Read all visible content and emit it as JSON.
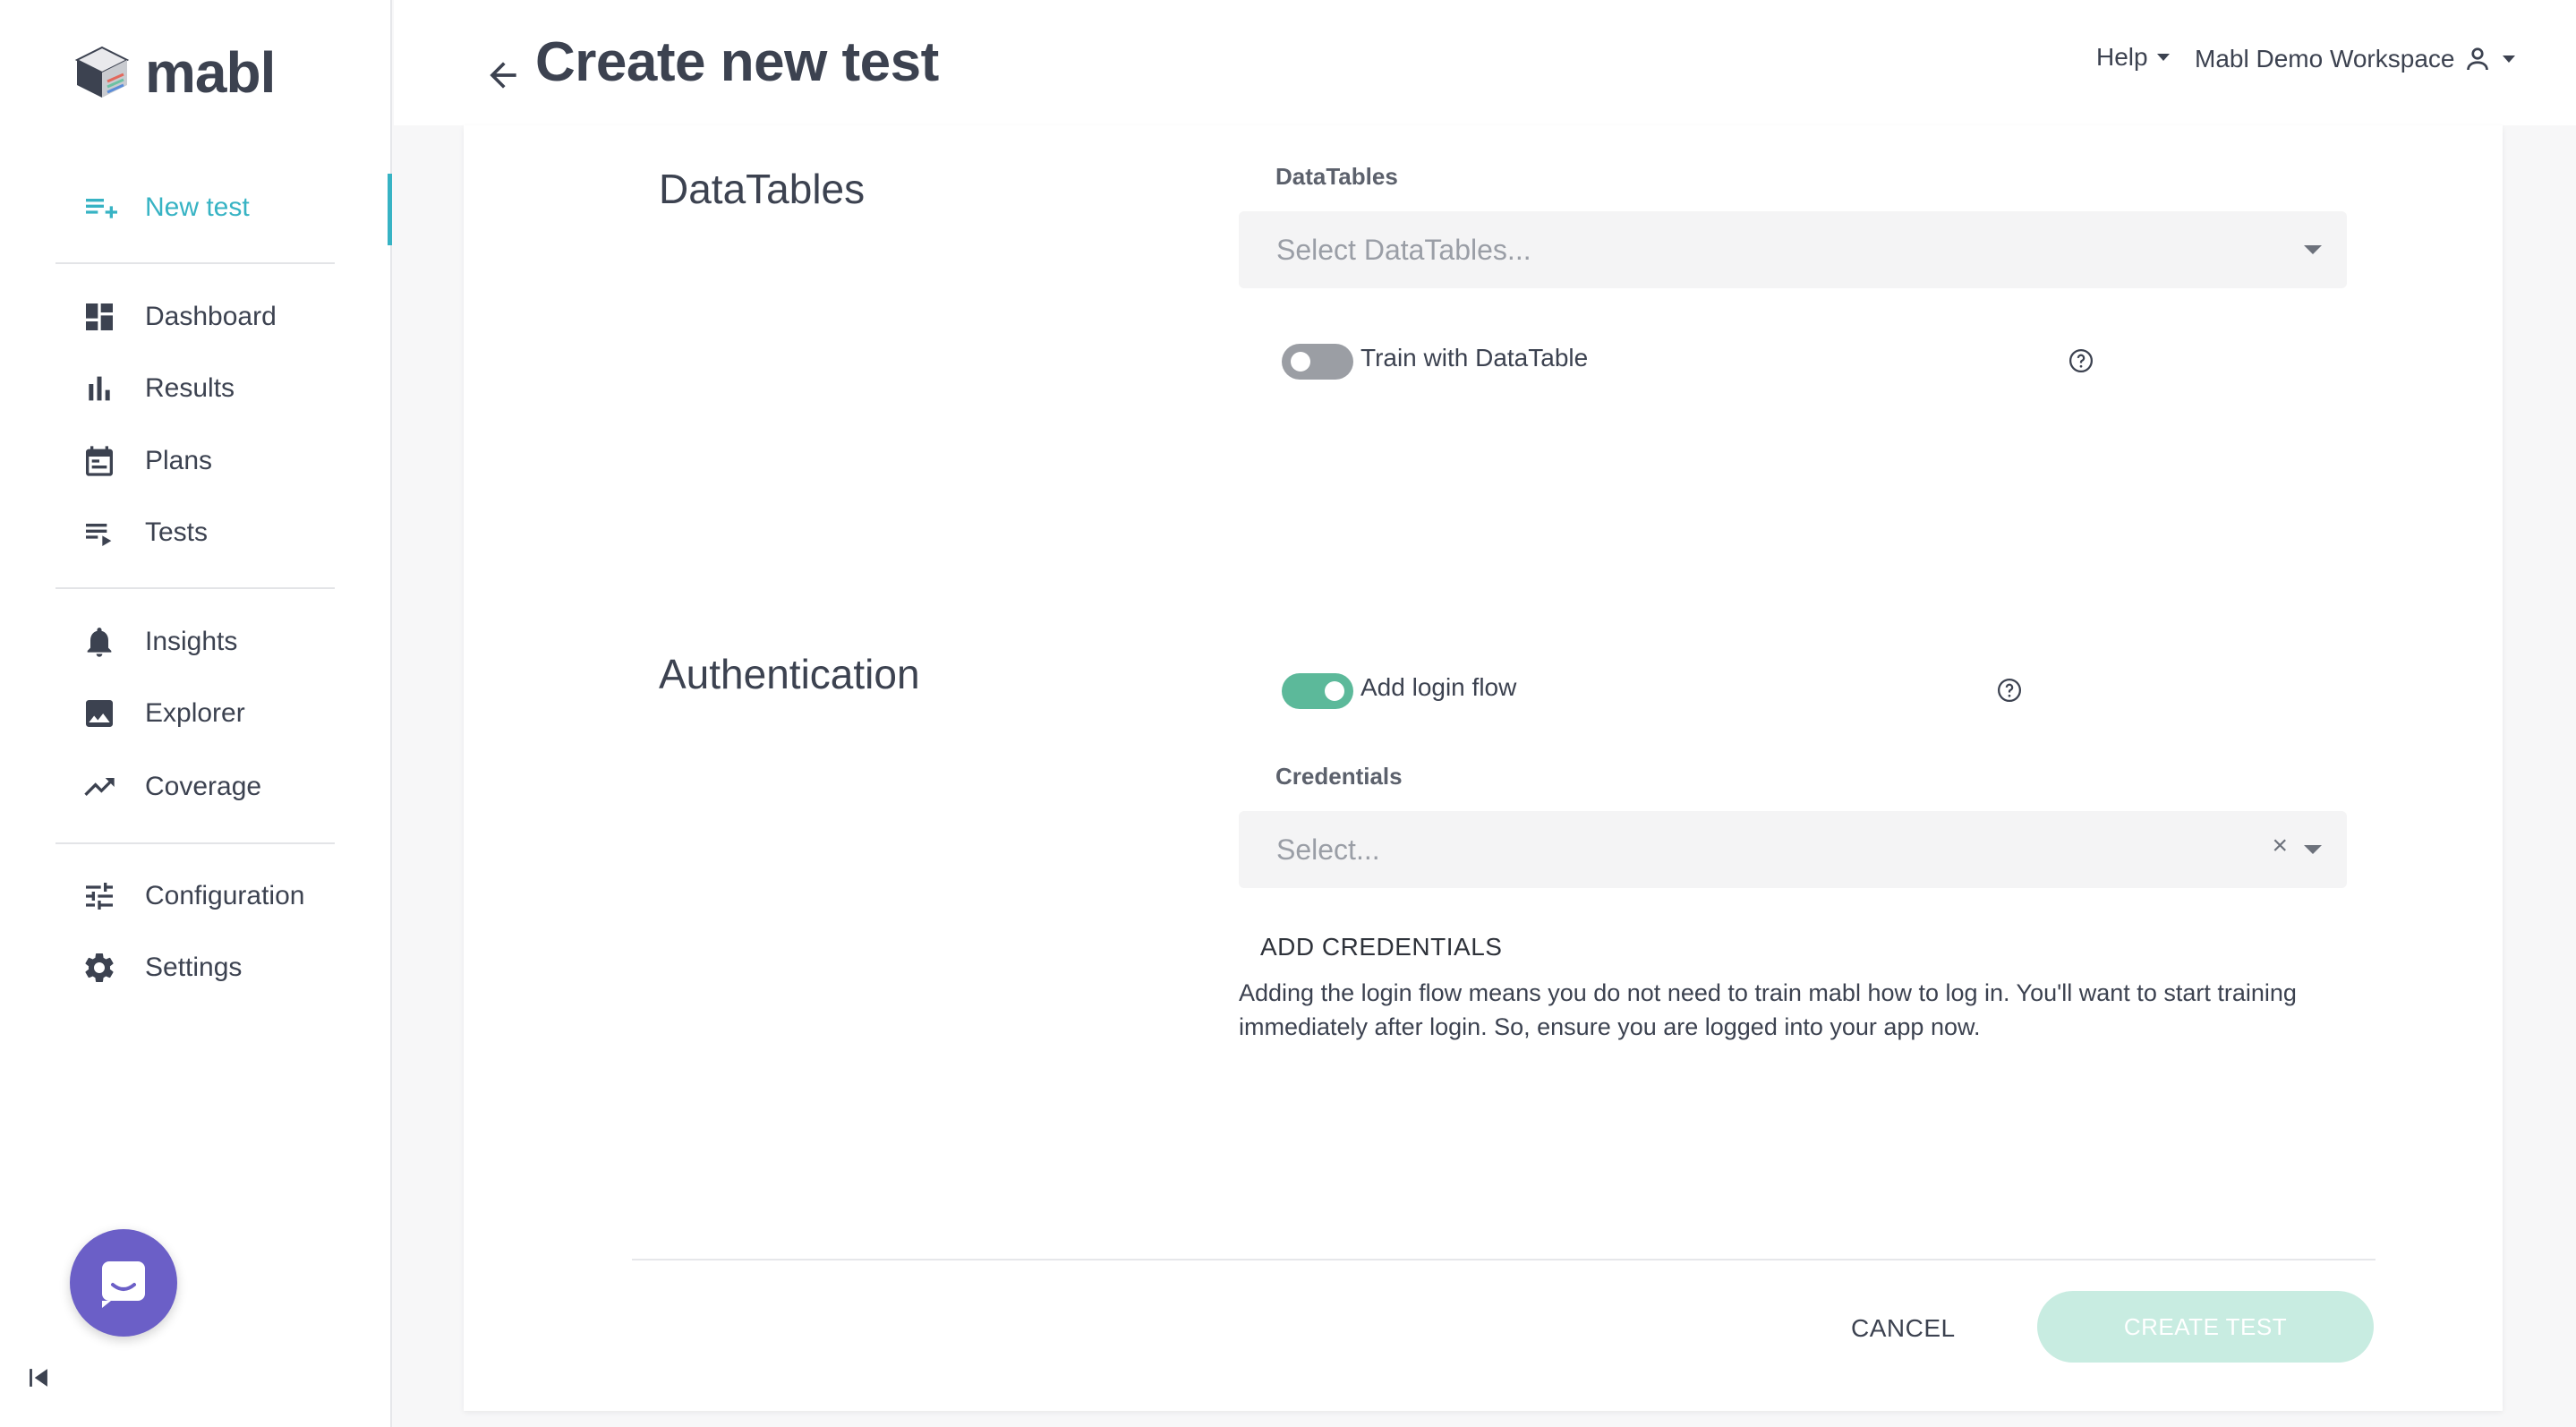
{
  "app": {
    "logo_text": "mabl"
  },
  "header": {
    "title": "Create new test",
    "help_label": "Help",
    "workspace_label": "Mabl Demo Workspace"
  },
  "sidebar": {
    "items": [
      {
        "label": "New test",
        "icon": "new-test-icon",
        "active": true
      },
      {
        "label": "Dashboard",
        "icon": "dashboard-icon"
      },
      {
        "label": "Results",
        "icon": "results-icon"
      },
      {
        "label": "Plans",
        "icon": "calendar-icon"
      },
      {
        "label": "Tests",
        "icon": "tests-icon"
      },
      {
        "label": "Insights",
        "icon": "bell-icon"
      },
      {
        "label": "Explorer",
        "icon": "image-icon"
      },
      {
        "label": "Coverage",
        "icon": "trending-icon"
      },
      {
        "label": "Configuration",
        "icon": "sliders-icon"
      },
      {
        "label": "Settings",
        "icon": "gear-icon"
      }
    ]
  },
  "datatables": {
    "section_title": "DataTables",
    "field_label": "DataTables",
    "placeholder": "Select DataTables...",
    "toggle_label": "Train with DataTable",
    "toggle_on": false
  },
  "authentication": {
    "section_title": "Authentication",
    "toggle_label": "Add login flow",
    "toggle_on": true,
    "credentials_label": "Credentials",
    "credentials_placeholder": "Select...",
    "clear_glyph": "×",
    "add_credentials_label": "ADD CREDENTIALS",
    "description": "Adding the login flow means you do not need to train mabl how to log in. You'll want to start training immediately after login. So, ensure you are logged into your app now."
  },
  "footer": {
    "cancel_label": "CANCEL",
    "create_label": "CREATE TEST"
  },
  "colors": {
    "accent": "#37b3c4",
    "toggle_on": "#5cb99a",
    "create_disabled": "#c8ece1",
    "chat": "#6b5fc7"
  }
}
